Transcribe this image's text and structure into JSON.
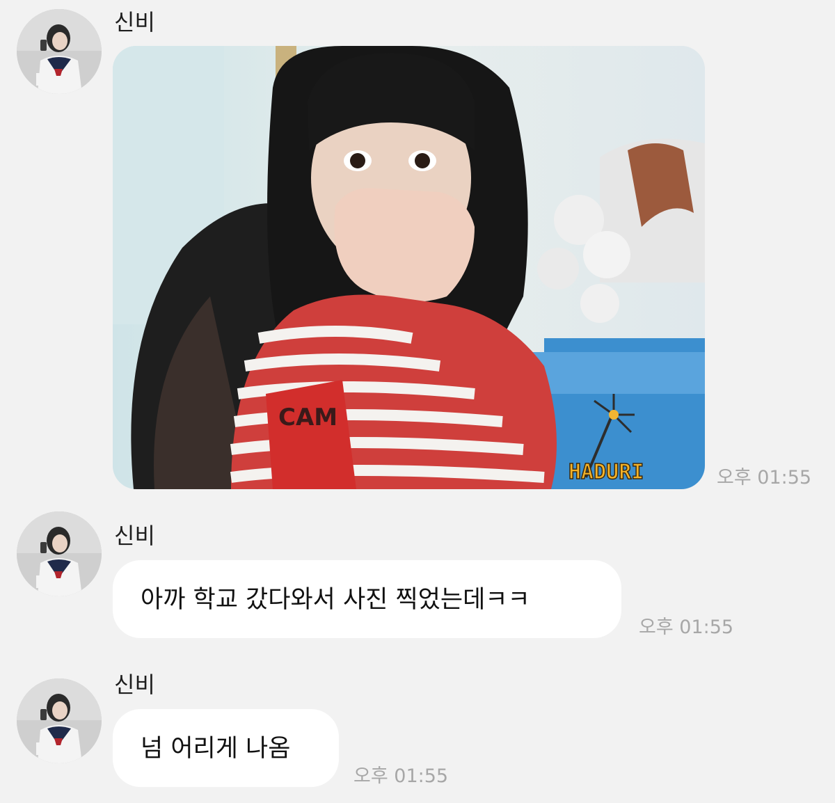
{
  "messages": [
    {
      "sender": "신비",
      "type": "image",
      "image": {
        "watermark": "HADURI",
        "shirt_text": "CAM"
      },
      "time": "오후 01:55"
    },
    {
      "sender": "신비",
      "type": "text",
      "text": "아까 학교 갔다와서 사진 찍었는데ㅋㅋ",
      "time": "오후 01:55"
    },
    {
      "sender": "신비",
      "type": "text",
      "text": "넘 어리게 나옴",
      "time": "오후 01:55"
    }
  ],
  "colors": {
    "background": "#f2f2f2",
    "bubble": "#ffffff",
    "timestamp": "#a7a7a7"
  }
}
